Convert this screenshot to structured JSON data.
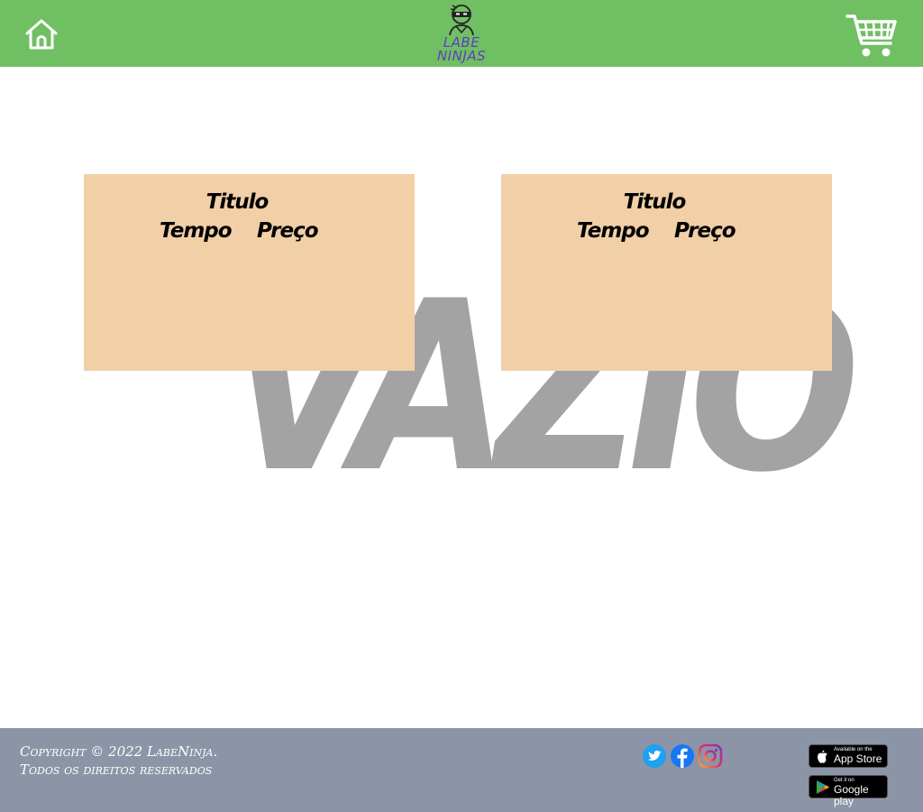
{
  "header": {
    "logo_line1": "LABE",
    "logo_line2": "NINJAS"
  },
  "empty_state": {
    "text": "VAZIO"
  },
  "cards": [
    {
      "title": "Titulo",
      "time_label": "Tempo",
      "price_label": "Preço"
    },
    {
      "title": "Titulo",
      "time_label": "Tempo",
      "price_label": "Preço"
    }
  ],
  "footer": {
    "copyright_line1": "Copyright © 2022 LabeNinja.",
    "copyright_line2": "Todos os direitos reservados",
    "app_store_small": "Available on the",
    "app_store_big": "App Store",
    "google_play_small": "Get it on",
    "google_play_big": "Google play"
  },
  "colors": {
    "header_bg": "#71bf63",
    "card_bg": "#f1cfa7",
    "footer_bg": "#8b95a7",
    "empty_text": "#a3a3a3",
    "logo_text": "#5c3fbf"
  },
  "icons": [
    "home-icon",
    "ninja-logo-icon",
    "cart-icon",
    "twitter-icon",
    "facebook-icon",
    "instagram-icon",
    "apple-icon",
    "google-play-icon"
  ]
}
